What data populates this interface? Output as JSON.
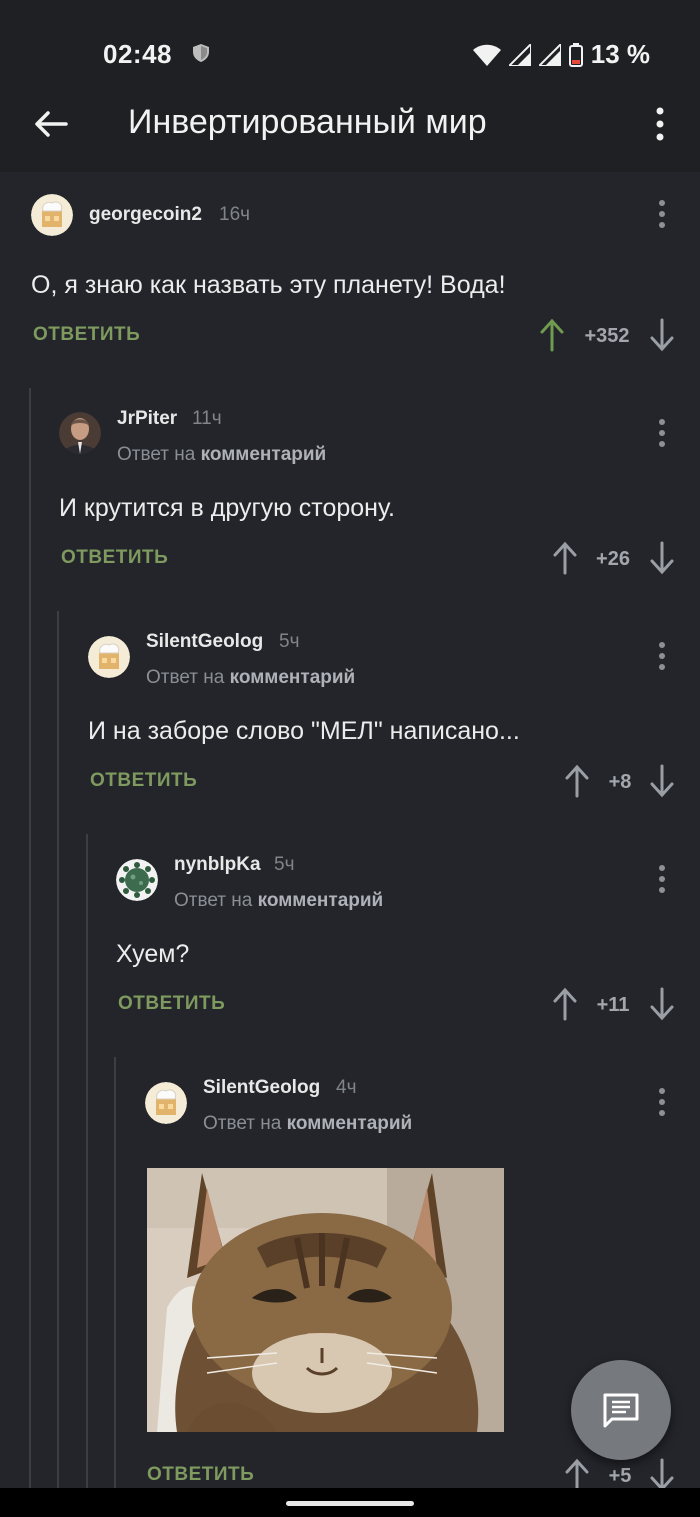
{
  "status_bar": {
    "time": "02:48",
    "battery": "13 %"
  },
  "app_bar": {
    "title": "Инвертированный мир"
  },
  "reply_label": "ОТВЕТИТЬ",
  "comments": [
    {
      "user": "georgecoin2",
      "time": "16ч",
      "text": "О, я знаю как назвать эту планету! Вода!",
      "score": "+352"
    },
    {
      "user": "JrPiter",
      "time": "11ч",
      "reply_prefix": "Ответ на",
      "reply_target": "комментарий",
      "text": "И крутится в другую сторону.",
      "score": "+26"
    },
    {
      "user": "SilentGeolog",
      "time": "5ч",
      "reply_prefix": "Ответ на",
      "reply_target": "комментарий",
      "text": "И на заборе слово \"МЕЛ\" написано...",
      "score": "+8"
    },
    {
      "user": "nynblpKa",
      "time": "5ч",
      "reply_prefix": "Ответ на",
      "reply_target": "комментарий",
      "text": "Хуем?",
      "score": "+11"
    },
    {
      "user": "SilentGeolog",
      "time": "4ч",
      "reply_prefix": "Ответ на",
      "reply_target": "комментарий",
      "score": "+5"
    }
  ],
  "colors": {
    "background": "#23252a",
    "reply_green": "#7e9a5f",
    "upvoted_green": "#6f9a4f",
    "fab": "#76797e"
  }
}
